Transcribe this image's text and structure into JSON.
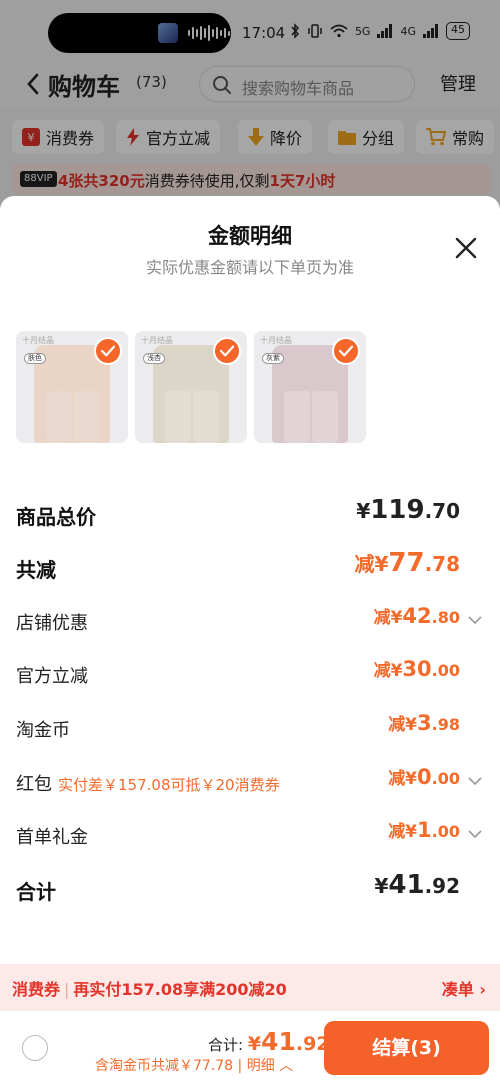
{
  "status_bar": {
    "time": "17:04",
    "battery": "45",
    "net1": "5G",
    "net2": "4G"
  },
  "header": {
    "title": "购物车",
    "count": "(73)",
    "search_placeholder": "搜索购物车商品",
    "manage": "管理"
  },
  "filters": [
    {
      "label": "消费券",
      "icon": "coupon-icon",
      "color": "#e3342a"
    },
    {
      "label": "官方立减",
      "icon": "lightning-icon",
      "color": "#e3342a"
    },
    {
      "label": "降价",
      "icon": "arrow-down-icon",
      "color": "#f5a623"
    },
    {
      "label": "分组",
      "icon": "folder-icon",
      "color": "#f5a623"
    },
    {
      "label": "常购",
      "icon": "cart-icon",
      "color": "#f5a623"
    }
  ],
  "coupon_strip": {
    "vip": "88VIP",
    "part1": "4张共320元",
    "part2": "消费券待使用,仅剩",
    "part3": "1天7小时"
  },
  "sheet": {
    "title": "金额明细",
    "subtitle": "实际优惠金额请以下单页为准",
    "products": [
      {
        "brand": "十月结晶",
        "tag": "肤色",
        "color": "#e9d4c6"
      },
      {
        "brand": "十月结晶",
        "tag": "浅杏",
        "color": "#dcd6c8"
      },
      {
        "brand": "十月结晶",
        "tag": "灰紫",
        "color": "#d9c8cc"
      }
    ],
    "rows": {
      "subtotal": {
        "label": "商品总价",
        "yen": "¥",
        "int": "119",
        "dec": ".70"
      },
      "total_discount": {
        "label": "共减",
        "prefix": "减¥",
        "int": "77",
        "dec": ".78"
      },
      "shop": {
        "label": "店铺优惠",
        "prefix": "减¥",
        "int": "42",
        "dec": ".80"
      },
      "official": {
        "label": "官方立减",
        "prefix": "减¥",
        "int": "30",
        "dec": ".00"
      },
      "coins": {
        "label": "淘金币",
        "prefix": "减¥",
        "int": "3",
        "dec": ".98"
      },
      "redpack": {
        "label": "红包",
        "note": "实付差￥157.08可抵￥20消费券",
        "prefix": "减¥",
        "int": "0",
        "dec": ".00"
      },
      "first_order": {
        "label": "首单礼金",
        "prefix": "减¥",
        "int": "1",
        "dec": ".00"
      },
      "total": {
        "label": "合计",
        "yen": "¥",
        "int": "41",
        "dec": ".92"
      }
    }
  },
  "promo_bar": {
    "tag": "消费券",
    "text": "再实付157.08享满200减20",
    "link": "凑单 ›"
  },
  "footer": {
    "total_label": "合计: ",
    "total_yen": "¥",
    "total_int": "41",
    "total_dec": ".92",
    "sub": "含淘金币共减￥77.78 | 明细 ︿",
    "checkout": "结算(3)"
  }
}
